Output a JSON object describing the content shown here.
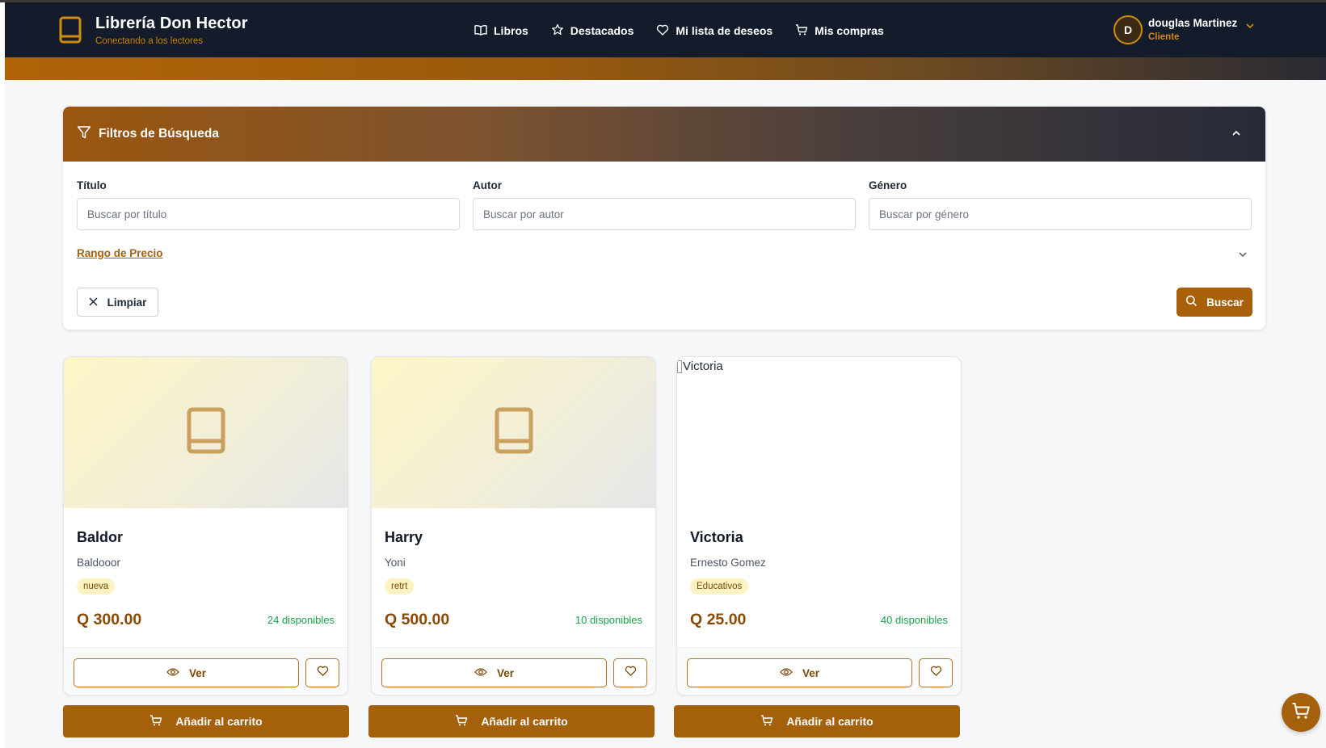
{
  "brand": {
    "title": "Librería Don Hector",
    "subtitle": "Conectando a los lectores",
    "icon": "book-icon"
  },
  "nav": {
    "links": [
      {
        "label": "Libros",
        "icon": "open-book-icon"
      },
      {
        "label": "Destacados",
        "icon": "star-icon"
      },
      {
        "label": "Mi lista de deseos",
        "icon": "heart-icon"
      },
      {
        "label": "Mis compras",
        "icon": "cart-icon"
      }
    ]
  },
  "user": {
    "initial": "D",
    "name": "douglas Martinez",
    "role": "Cliente"
  },
  "filters": {
    "title": "Filtros de Búsqueda",
    "fields": [
      {
        "label": "Título",
        "placeholder": "Buscar por título",
        "value": ""
      },
      {
        "label": "Autor",
        "placeholder": "Buscar por autor",
        "value": ""
      },
      {
        "label": "Género",
        "placeholder": "Buscar por género",
        "value": ""
      }
    ],
    "price_range_label": "Rango de Precio",
    "clear_label": "Limpiar",
    "search_label": "Buscar"
  },
  "books": [
    {
      "title": "Baldor",
      "author": "Baldooor",
      "genre": "nueva",
      "price": "Q 300.00",
      "stock": "24 disponibles",
      "image": "placeholder",
      "image_alt": ""
    },
    {
      "title": "Harry",
      "author": "Yoni",
      "genre": "retrt",
      "price": "Q 500.00",
      "stock": "10 disponibles",
      "image": "placeholder",
      "image_alt": ""
    },
    {
      "title": "Victoria",
      "author": "Ernesto Gomez",
      "genre": "Educativos",
      "price": "Q 25.00",
      "stock": "40 disponibles",
      "image": "broken",
      "image_alt": "Victoria"
    }
  ],
  "card_actions": {
    "view_label": "Ver",
    "add_to_cart_label": "Añadir al carrito"
  },
  "colors": {
    "accent": "#a5600b",
    "navbar": "#141b2a",
    "stock_green": "#16a34a"
  }
}
